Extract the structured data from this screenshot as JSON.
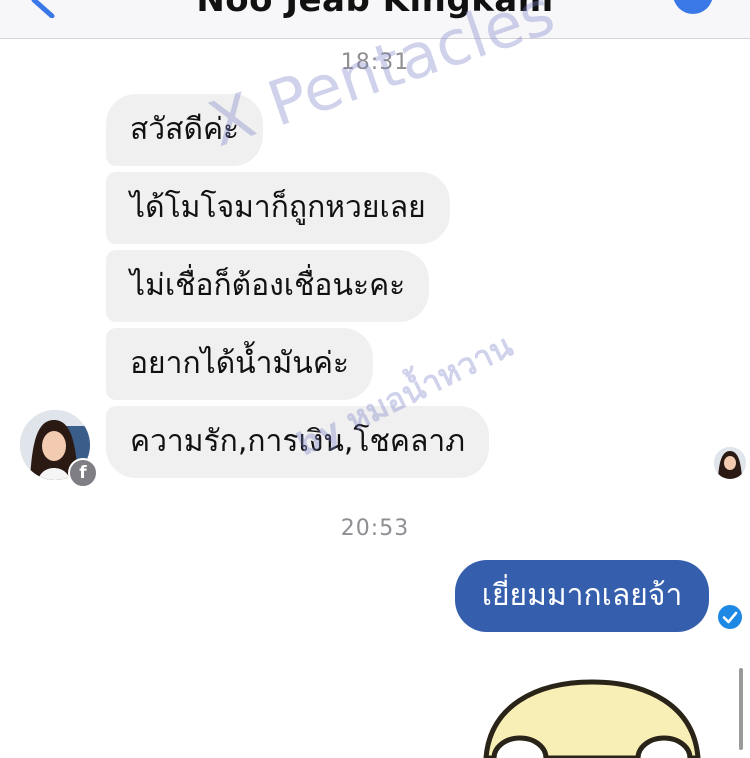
{
  "header": {
    "title": "Noo Jeab Kingkam",
    "back_icon": "chevron-left-icon",
    "info_icon": "info-icon",
    "accent": "#3b78e7"
  },
  "conversation": {
    "timestamp_1": "18:31",
    "received_messages": [
      "สวัสดีค่ะ",
      "ได้โมโจมาก็ถูกหวยเลย",
      "ไม่เชื่อก็ต้องเชื่อนะคะ",
      "อยากได้น้ำมันค่ะ",
      "ความรัก,การเงิน,โชคลาภ"
    ],
    "timestamp_2": "20:53",
    "sent_messages": [
      "เยี่ยมมากเลยจ้า"
    ],
    "sent_bubble_color": "#355fad",
    "received_bubble_color": "#f0f0f0"
  },
  "watermark": {
    "line1": "X Pentacles",
    "line2": "by หมอน้ำหวาน"
  },
  "icons": {
    "facebook_badge": "f",
    "delivered": "check-circle-icon"
  }
}
